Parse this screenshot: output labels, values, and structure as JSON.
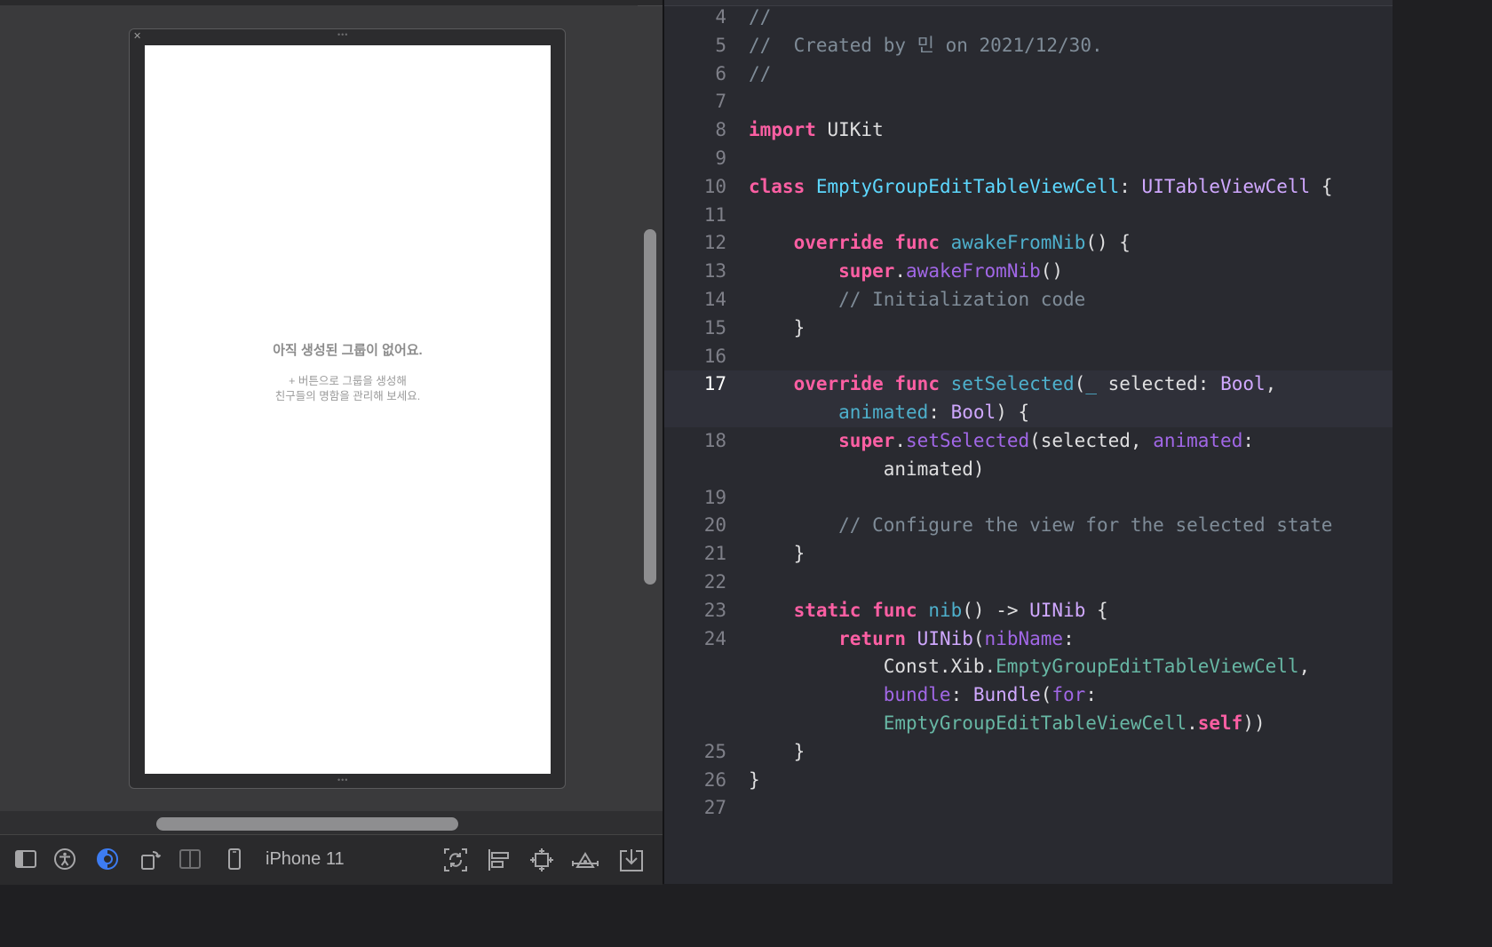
{
  "interface_builder": {
    "empty_state": {
      "title": "아직 생성된 그룹이 없어요.",
      "subtitle_line1": "+ 버튼으로 그룹을 생성해",
      "subtitle_line2": "친구들의 명함을 관리해 보세요."
    },
    "toolbar": {
      "device_label": "iPhone 11",
      "icons": [
        "sidebar-toggle-icon",
        "accessibility-icon",
        "appearance-icon",
        "orientation-icon",
        "split-view-icon",
        "device-icon",
        "update-frames-icon",
        "align-icon",
        "embed-icon",
        "constraints-icon",
        "resolve-issues-icon"
      ]
    }
  },
  "editor": {
    "current_line": 17,
    "lines": [
      {
        "n": "4",
        "parts": [
          {
            "c": "cm",
            "t": "//"
          }
        ]
      },
      {
        "n": "5",
        "parts": [
          {
            "c": "cm",
            "t": "//  Created by 민 on 2021/12/30."
          }
        ]
      },
      {
        "n": "6",
        "parts": [
          {
            "c": "cm",
            "t": "//"
          }
        ]
      },
      {
        "n": "7",
        "parts": []
      },
      {
        "n": "8",
        "parts": [
          {
            "c": "kw",
            "t": "import"
          },
          {
            "c": "pl",
            "t": " UIKit"
          }
        ]
      },
      {
        "n": "9",
        "parts": []
      },
      {
        "n": "10",
        "parts": [
          {
            "c": "kw",
            "t": "class"
          },
          {
            "c": "pl",
            "t": " "
          },
          {
            "c": "cl",
            "t": "EmptyGroupEditTableViewCell"
          },
          {
            "c": "pl",
            "t": ": "
          },
          {
            "c": "ty",
            "t": "UITableViewCell"
          },
          {
            "c": "pl",
            "t": " {"
          }
        ]
      },
      {
        "n": "11",
        "parts": []
      },
      {
        "n": "12",
        "parts": [
          {
            "c": "pl",
            "t": "    "
          },
          {
            "c": "kw",
            "t": "override"
          },
          {
            "c": "pl",
            "t": " "
          },
          {
            "c": "kw",
            "t": "func"
          },
          {
            "c": "pl",
            "t": " "
          },
          {
            "c": "md",
            "t": "awakeFromNib"
          },
          {
            "c": "pl",
            "t": "() {"
          }
        ]
      },
      {
        "n": "13",
        "parts": [
          {
            "c": "pl",
            "t": "        "
          },
          {
            "c": "kw",
            "t": "super"
          },
          {
            "c": "pl",
            "t": "."
          },
          {
            "c": "pm",
            "t": "awakeFromNib"
          },
          {
            "c": "pl",
            "t": "()"
          }
        ]
      },
      {
        "n": "14",
        "parts": [
          {
            "c": "pl",
            "t": "        "
          },
          {
            "c": "cm",
            "t": "// Initialization code"
          }
        ]
      },
      {
        "n": "15",
        "parts": [
          {
            "c": "pl",
            "t": "    }"
          }
        ]
      },
      {
        "n": "16",
        "parts": []
      },
      {
        "n": "17",
        "hl": true,
        "parts": [
          {
            "c": "pl",
            "t": "    "
          },
          {
            "c": "kw",
            "t": "override"
          },
          {
            "c": "pl",
            "t": " "
          },
          {
            "c": "kw",
            "t": "func"
          },
          {
            "c": "pl",
            "t": " "
          },
          {
            "c": "md",
            "t": "setSelected"
          },
          {
            "c": "pl",
            "t": "("
          },
          {
            "c": "md",
            "t": "_"
          },
          {
            "c": "pl",
            "t": " selected: "
          },
          {
            "c": "ty",
            "t": "Bool"
          },
          {
            "c": "pl",
            "t": ","
          }
        ]
      },
      {
        "n": "",
        "hl": true,
        "parts": [
          {
            "c": "pl",
            "t": "        "
          },
          {
            "c": "md",
            "t": "animated"
          },
          {
            "c": "pl",
            "t": ": "
          },
          {
            "c": "ty",
            "t": "Bool"
          },
          {
            "c": "pl",
            "t": ") {"
          }
        ]
      },
      {
        "n": "18",
        "parts": [
          {
            "c": "pl",
            "t": "        "
          },
          {
            "c": "kw",
            "t": "super"
          },
          {
            "c": "pl",
            "t": "."
          },
          {
            "c": "pm",
            "t": "setSelected"
          },
          {
            "c": "pl",
            "t": "(selected, "
          },
          {
            "c": "pm",
            "t": "animated"
          },
          {
            "c": "pl",
            "t": ":"
          }
        ]
      },
      {
        "n": "",
        "parts": [
          {
            "c": "pl",
            "t": "            animated)"
          }
        ]
      },
      {
        "n": "19",
        "parts": []
      },
      {
        "n": "20",
        "parts": [
          {
            "c": "pl",
            "t": "        "
          },
          {
            "c": "cm",
            "t": "// Configure the view for the selected state"
          }
        ]
      },
      {
        "n": "21",
        "parts": [
          {
            "c": "pl",
            "t": "    }"
          }
        ]
      },
      {
        "n": "22",
        "parts": []
      },
      {
        "n": "23",
        "parts": [
          {
            "c": "pl",
            "t": "    "
          },
          {
            "c": "kw",
            "t": "static"
          },
          {
            "c": "pl",
            "t": " "
          },
          {
            "c": "kw",
            "t": "func"
          },
          {
            "c": "pl",
            "t": " "
          },
          {
            "c": "md",
            "t": "nib"
          },
          {
            "c": "pl",
            "t": "() -> "
          },
          {
            "c": "ty",
            "t": "UINib"
          },
          {
            "c": "pl",
            "t": " {"
          }
        ]
      },
      {
        "n": "24",
        "parts": [
          {
            "c": "pl",
            "t": "        "
          },
          {
            "c": "kw",
            "t": "return"
          },
          {
            "c": "pl",
            "t": " "
          },
          {
            "c": "ty",
            "t": "UINib"
          },
          {
            "c": "pl",
            "t": "("
          },
          {
            "c": "pm",
            "t": "nibName"
          },
          {
            "c": "pl",
            "t": ":"
          }
        ]
      },
      {
        "n": "",
        "parts": [
          {
            "c": "pl",
            "t": "            Const.Xib."
          },
          {
            "c": "fn",
            "t": "EmptyGroupEditTableViewCell"
          },
          {
            "c": "pl",
            "t": ","
          }
        ]
      },
      {
        "n": "",
        "parts": [
          {
            "c": "pl",
            "t": "            "
          },
          {
            "c": "pm",
            "t": "bundle"
          },
          {
            "c": "pl",
            "t": ": "
          },
          {
            "c": "ty",
            "t": "Bundle"
          },
          {
            "c": "pl",
            "t": "("
          },
          {
            "c": "pm",
            "t": "for"
          },
          {
            "c": "pl",
            "t": ":"
          }
        ]
      },
      {
        "n": "",
        "parts": [
          {
            "c": "pl",
            "t": "            "
          },
          {
            "c": "fn",
            "t": "EmptyGroupEditTableViewCell"
          },
          {
            "c": "pl",
            "t": "."
          },
          {
            "c": "kw",
            "t": "self"
          },
          {
            "c": "pl",
            "t": "))"
          }
        ]
      },
      {
        "n": "25",
        "parts": [
          {
            "c": "pl",
            "t": "    }"
          }
        ]
      },
      {
        "n": "26",
        "parts": [
          {
            "c": "pl",
            "t": "}"
          }
        ]
      },
      {
        "n": "27",
        "parts": []
      }
    ]
  }
}
